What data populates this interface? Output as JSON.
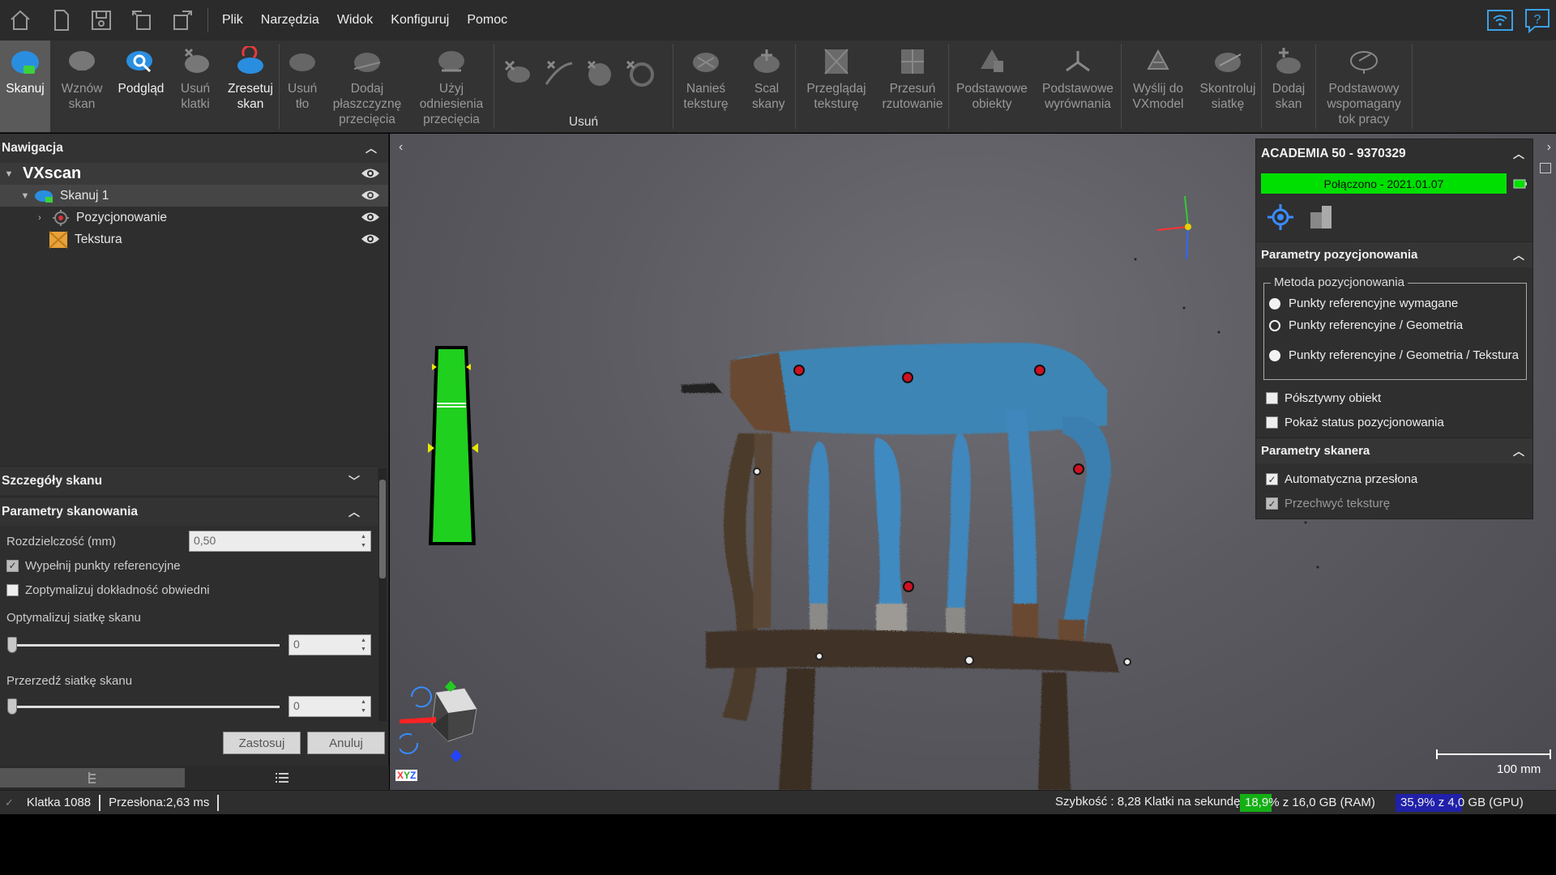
{
  "menubar": {
    "quick_access": [
      "home-icon",
      "new-file-icon",
      "save-icon",
      "undo-icon",
      "redo-icon"
    ],
    "menus": [
      "Plik",
      "Narzędzia",
      "Widok",
      "Konfiguruj",
      "Pomoc"
    ]
  },
  "ribbon": {
    "buttons": [
      {
        "label": "Skanuj",
        "icon": "scan-icon",
        "state": "active"
      },
      {
        "label": "Wznów skan",
        "icon": "resume-scan-icon"
      },
      {
        "label": "Podgląd",
        "icon": "preview-icon",
        "state": "bright"
      },
      {
        "label": "Usuń klatki",
        "icon": "delete-frames-icon"
      },
      {
        "label": "Zresetuj skan",
        "icon": "reset-scan-icon",
        "state": "bright"
      },
      {
        "label": "Usuń tło",
        "icon": "remove-background-icon"
      },
      {
        "label": "Dodaj płaszczyznę przecięcia",
        "icon": "add-cut-plane-icon"
      },
      {
        "label": "Użyj odniesienia przecięcia",
        "icon": "use-cut-reference-icon"
      },
      {
        "label": "Nanieś teksturę",
        "icon": "apply-texture-icon"
      },
      {
        "label": "Scal skany",
        "icon": "merge-scans-icon"
      },
      {
        "label": "Przeglądaj teksturę",
        "icon": "browse-texture-icon"
      },
      {
        "label": "Przesuń rzutowanie",
        "icon": "move-projection-icon"
      },
      {
        "label": "Podstawowe obiekty",
        "icon": "basic-objects-icon"
      },
      {
        "label": "Podstawowe wyrównania",
        "icon": "basic-alignments-icon"
      },
      {
        "label": "Wyślij do VXmodel",
        "icon": "send-vxmodel-icon"
      },
      {
        "label": "Skontroluj siatkę",
        "icon": "check-mesh-icon"
      },
      {
        "label": "Dodaj skan",
        "icon": "add-scan-icon"
      },
      {
        "label": "Podstawowy wspomagany tok pracy",
        "icon": "guided-workflow-icon"
      }
    ],
    "delete_group_label": "Usuń"
  },
  "navigation": {
    "title": "Nawigacja",
    "root": "VXscan",
    "items": [
      {
        "label": "Skanuj 1",
        "icon": "scan-item-icon"
      },
      {
        "label": "Pozycjonowanie",
        "icon": "positioning-icon"
      },
      {
        "label": "Tekstura",
        "icon": "texture-icon"
      }
    ]
  },
  "scan_details": {
    "title": "Szczegóły skanu"
  },
  "scan_params": {
    "title": "Parametry skanowania",
    "resolution_label": "Rozdzielczość (mm)",
    "resolution_value": "0,50",
    "fill_targets_label": "Wypełnij punkty referencyjne",
    "fill_targets_checked": true,
    "optimize_label": "Zoptymalizuj dokładność obwiedni",
    "optimize_checked": false,
    "optimize_mesh_label": "Optymalizuj siatkę skanu",
    "optimize_mesh_value": "0",
    "decimate_label": "Przerzedź siatkę skanu",
    "decimate_value": "0",
    "apply_label": "Zastosuj",
    "cancel_label": "Anuluj"
  },
  "device_panel": {
    "title": "ACADEMIA 50 - 9370329",
    "status": "Połączono - 2021.01.07",
    "status_color": "#00e000",
    "positioning_title": "Parametry pozycjonowania",
    "method_title": "Metoda pozycjonowania",
    "methods": [
      "Punkty referencyjne wymagane",
      "Punkty referencyjne / Geometria",
      "Punkty referencyjne / Geometria / Tekstura"
    ],
    "selected_method": 1,
    "semi_rigid_label": "Półsztywny obiekt",
    "show_status_label": "Pokaż status pozycjonowania",
    "scanner_title": "Parametry skanera",
    "auto_shutter_label": "Automatyczna przesłona",
    "auto_shutter_checked": true,
    "capture_texture_label": "Przechwyć teksturę",
    "capture_texture_checked": true
  },
  "viewport": {
    "scale_label": "100 mm",
    "axes_label": [
      "X",
      "Y",
      "Z"
    ],
    "axis_colors": {
      "x": "#ff3333",
      "y": "#33cc33",
      "z": "#3366ff"
    }
  },
  "statusbar": {
    "frame": "Klatka 1088",
    "shutter": "Przesłona:2,63 ms",
    "speed": "Szybkość : 8,28 Klatki na sekundę",
    "ram_percent": "18,9%",
    "ram_text": " z 16,0 GB (RAM)",
    "ram_fraction": 0.189,
    "gpu_percent": "35,9%",
    "gpu_text": " z 4,0 GB (GPU)",
    "gpu_fraction": 0.359
  }
}
